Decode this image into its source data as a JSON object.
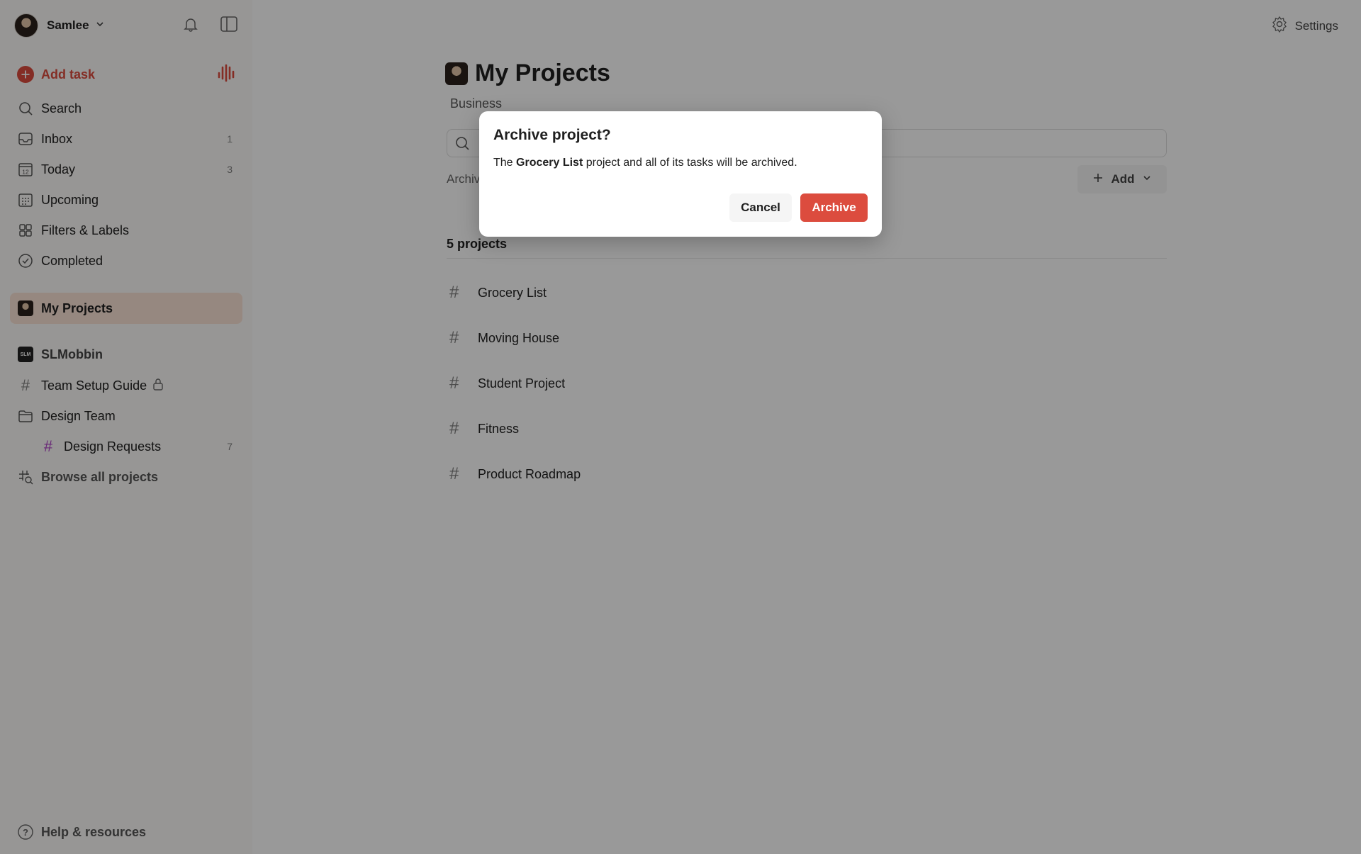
{
  "sidebar": {
    "user_name": "Samlee",
    "add_task": "Add task",
    "nav": [
      {
        "label": "Search",
        "count": ""
      },
      {
        "label": "Inbox",
        "count": "1"
      },
      {
        "label": "Today",
        "count": "3"
      },
      {
        "label": "Upcoming",
        "count": ""
      },
      {
        "label": "Filters & Labels",
        "count": ""
      },
      {
        "label": "Completed",
        "count": ""
      }
    ],
    "my_projects": "My Projects",
    "workspace": "SLMobbin",
    "team_setup_guide": "Team Setup Guide",
    "design_team": "Design Team",
    "design_requests": {
      "label": "Design Requests",
      "count": "7"
    },
    "browse_all": "Browse all projects",
    "help": "Help & resources",
    "today_icon_number": "12",
    "workspace_badge": "SLM"
  },
  "header": {
    "settings": "Settings"
  },
  "main": {
    "title": "My Projects",
    "subtitle": "Business",
    "archived_tab": "Archiv",
    "add_button": "Add",
    "project_count": "5 projects",
    "projects": [
      "Grocery List",
      "Moving House",
      "Student Project",
      "Fitness",
      "Product Roadmap"
    ]
  },
  "dialog": {
    "title": "Archive project?",
    "body_prefix": "The ",
    "body_project": "Grocery List",
    "body_suffix": " project and all of its tasks will be archived.",
    "cancel": "Cancel",
    "archive": "Archive"
  },
  "colors": {
    "accent": "#dc4c3e",
    "active_bg": "#fbe3d6",
    "sidebar_bg": "#fcfaf8"
  }
}
